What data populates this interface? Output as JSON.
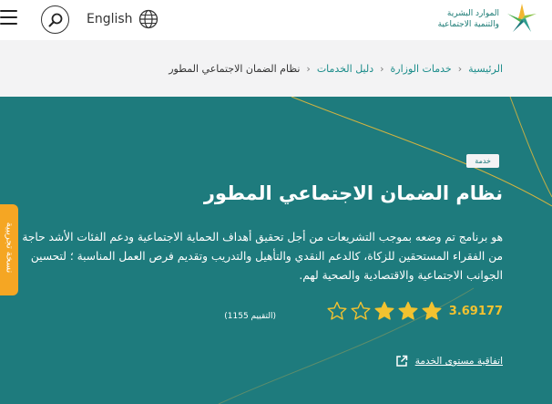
{
  "header": {
    "language_label": "English",
    "logo_line1": "الموارد البشرية",
    "logo_line2": "والتنمية الاجتماعية"
  },
  "breadcrumb": {
    "items": [
      "الرئيسية",
      "خدمات الوزارة",
      "دليل الخدمات"
    ],
    "current": "نظام الضمان الاجتماعي المطور"
  },
  "hero": {
    "badge": "خدمة",
    "title": "نظام الضمان الاجتماعي المطور",
    "description": "هو برنامج تم وضعه بموجب التشريعات من أجل تحقيق أهداف الحماية الاجتماعية ودعم الفئات الأشد حاجة من الفقراء المستحقين للزكاة، كالدعم النقدي والتأهيل والتدريب وتقديم فرص العمل المناسبة ؛ لتحسين الجوانب الاجتماعية والاقتصادية والصحية لهم.",
    "rating_value": "3.69177",
    "rating_stars": 3,
    "rating_max": 5,
    "rating_count": "(التقييم 1155)",
    "sla_label": "اتفاقية مستوى الخدمة"
  },
  "side_tab": {
    "label": "نسخة تجريبية"
  },
  "colors": {
    "hero_bg": "#1e7b7d",
    "accent_gold": "#f2c230",
    "side_tab": "#f5a623",
    "link_teal": "#1b8c8a"
  }
}
